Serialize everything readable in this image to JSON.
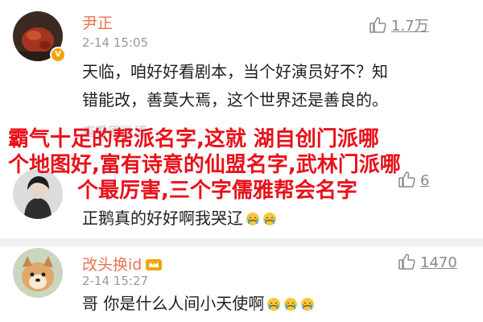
{
  "comments": [
    {
      "username": "尹正",
      "timestamp": "2-14 15:05",
      "likes": "1.7万",
      "text_lines": [
        "天临，咱好好看剧本，当个好演员好不？知",
        "错能改，善莫大焉，这个世界还是善良的。"
      ],
      "partial_line": "查看原微博"
    },
    {
      "username": "",
      "timestamp": "",
      "likes": "6",
      "text": "正鹅真的好好啊我哭辽"
    },
    {
      "username": "改头换id",
      "timestamp": "2-14 15:27",
      "likes": "1470",
      "text": "哥 你是什么人间小天使啊"
    }
  ],
  "overlay_lines": [
    "霸气十足的帮派名字,这就  湖自创门派哪",
    "个地图好,富有诗意的仙盟名字,武林门派哪",
    "个最厉害,三个字儒雅帮会名字"
  ],
  "colors": {
    "username": "#eb7350",
    "overlay": "#e8111b",
    "timestamp": "#9a9a9a",
    "like": "#8a8a8a",
    "badge": "#f2a40c"
  }
}
